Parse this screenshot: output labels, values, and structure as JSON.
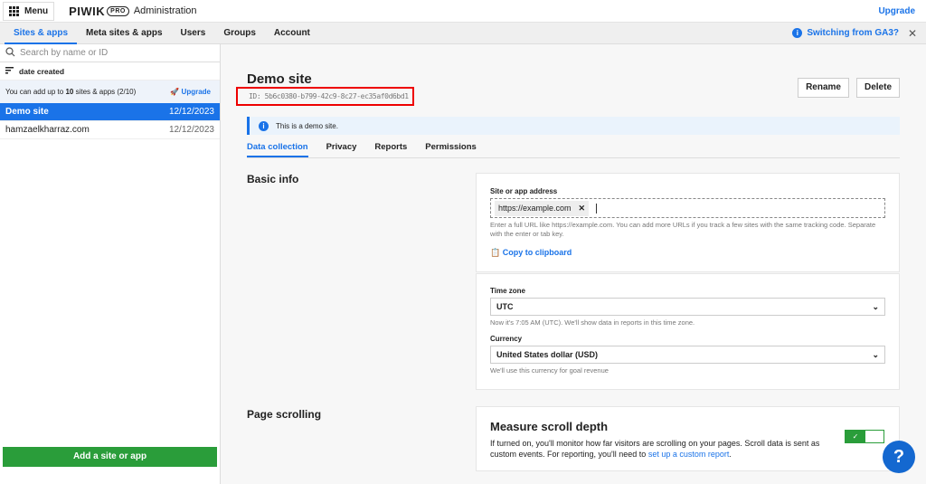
{
  "topbar": {
    "menu_label": "Menu",
    "logo": "PIWIK PRO",
    "section": "Administration",
    "upgrade": "Upgrade"
  },
  "nav": {
    "items": [
      "Sites & apps",
      "Meta sites & apps",
      "Users",
      "Groups",
      "Account"
    ],
    "ga3": "Switching from GA3?"
  },
  "sidebar": {
    "search_placeholder": "Search by name or ID",
    "sort": "date created",
    "limit_pre": "You can add up to ",
    "limit_num": "10",
    "limit_post": " sites & apps (2/10)",
    "upgrade": "Upgrade",
    "sites": [
      {
        "name": "Demo site",
        "date": "12/12/2023",
        "selected": true
      },
      {
        "name": "hamzaelkharraz.com",
        "date": "12/12/2023"
      }
    ],
    "add_button": "Add a site or app"
  },
  "main": {
    "title": "Demo site",
    "id": "ID: 5b6c0380-b799-42c9-8c27-ec35af0d6bd1",
    "rename": "Rename",
    "delete": "Delete",
    "notice": "This is a demo site.",
    "tabs": [
      "Data collection",
      "Privacy",
      "Reports",
      "Permissions"
    ],
    "basic_info": {
      "title": "Basic info",
      "address_label": "Site or app address",
      "address_chip": "https://example.com",
      "address_hint": "Enter a full URL like https://example.com. You can add more URLs if you track a few sites with the same tracking code. Separate with the enter or tab key.",
      "copy": "Copy to clipboard",
      "timezone_label": "Time zone",
      "timezone_value": "UTC",
      "timezone_hint": "Now it's 7:05 AM (UTC). We'll show data in reports in this time zone.",
      "currency_label": "Currency",
      "currency_value": "United States dollar (USD)",
      "currency_hint": "We'll use this currency for goal revenue"
    },
    "scrolling": {
      "title": "Page scrolling",
      "card_title": "Measure scroll depth",
      "desc": "If turned on, you'll monitor how far visitors are scrolling on your pages. Scroll data is sent as custom events. For reporting, you'll need to ",
      "link": "set up a custom report",
      "end": ".",
      "enabled": true
    }
  },
  "help": "?",
  "colors": {
    "accent": "#1a73e8",
    "success": "#2a9d3a",
    "highlight": "#e00000"
  }
}
